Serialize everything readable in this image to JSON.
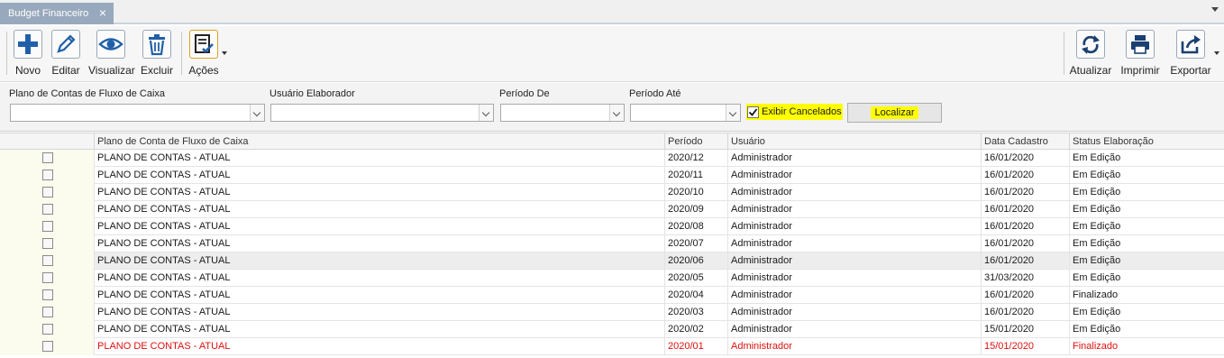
{
  "tab": {
    "title": "Budget Financeiro",
    "close": "×"
  },
  "toolbar": {
    "novo": "Novo",
    "editar": "Editar",
    "visualizar": "Visualizar",
    "excluir": "Excluir",
    "acoes": "Ações",
    "atualizar": "Atualizar",
    "imprimir": "Imprimir",
    "exportar": "Exportar"
  },
  "filters": {
    "plano_label": "Plano de Contas de Fluxo de Caixa",
    "plano_value": "",
    "usuario_label": "Usuário Elaborador",
    "usuario_value": "",
    "periodo_de_label": "Período De",
    "periodo_de_value": "",
    "periodo_ate_label": "Período Até",
    "periodo_ate_value": "",
    "exibir_cancelados_label": "Exibir Cancelados",
    "exibir_cancelados_checked": true,
    "localizar": "Localizar"
  },
  "grid": {
    "columns": [
      "Plano de Conta de Fluxo de Caixa",
      "Período",
      "Usuário",
      "Data Cadastro",
      "Status Elaboração"
    ],
    "rows": [
      {
        "plano": "PLANO DE CONTAS - ATUAL",
        "periodo": "2020/12",
        "usuario": "Administrador",
        "data": "16/01/2020",
        "status": "Em Edição"
      },
      {
        "plano": "PLANO DE CONTAS - ATUAL",
        "periodo": "2020/11",
        "usuario": "Administrador",
        "data": "16/01/2020",
        "status": "Em Edição"
      },
      {
        "plano": "PLANO DE CONTAS - ATUAL",
        "periodo": "2020/10",
        "usuario": "Administrador",
        "data": "16/01/2020",
        "status": "Em Edição"
      },
      {
        "plano": "PLANO DE CONTAS - ATUAL",
        "periodo": "2020/09",
        "usuario": "Administrador",
        "data": "16/01/2020",
        "status": "Em Edição"
      },
      {
        "plano": "PLANO DE CONTAS - ATUAL",
        "periodo": "2020/08",
        "usuario": "Administrador",
        "data": "16/01/2020",
        "status": "Em Edição"
      },
      {
        "plano": "PLANO DE CONTAS - ATUAL",
        "periodo": "2020/07",
        "usuario": "Administrador",
        "data": "16/01/2020",
        "status": "Em Edição"
      },
      {
        "plano": "PLANO DE CONTAS - ATUAL",
        "periodo": "2020/06",
        "usuario": "Administrador",
        "data": "16/01/2020",
        "status": "Em Edição"
      },
      {
        "plano": "PLANO DE CONTAS - ATUAL",
        "periodo": "2020/05",
        "usuario": "Administrador",
        "data": "31/03/2020",
        "status": "Em Edição"
      },
      {
        "plano": "PLANO DE CONTAS - ATUAL",
        "periodo": "2020/04",
        "usuario": "Administrador",
        "data": "16/01/2020",
        "status": "Finalizado"
      },
      {
        "plano": "PLANO DE CONTAS - ATUAL",
        "periodo": "2020/03",
        "usuario": "Administrador",
        "data": "16/01/2020",
        "status": "Em Edição"
      },
      {
        "plano": "PLANO DE CONTAS - ATUAL",
        "periodo": "2020/02",
        "usuario": "Administrador",
        "data": "15/01/2020",
        "status": "Em Edição"
      },
      {
        "plano": "PLANO DE CONTAS - ATUAL",
        "periodo": "2020/01",
        "usuario": "Administrador",
        "data": "15/01/2020",
        "status": "Finalizado",
        "cancelled": true
      }
    ]
  },
  "colors": {
    "icon_blue": "#2060a8",
    "highlight": "#ffff00",
    "cancelled_text": "#e01010",
    "tab_bg": "#98a9bd"
  }
}
